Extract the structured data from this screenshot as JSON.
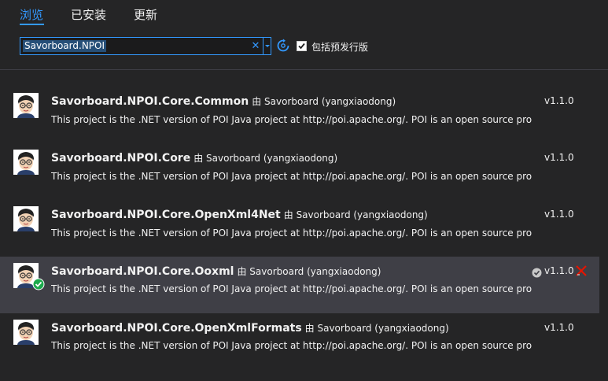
{
  "tabs": [
    {
      "label": "浏览",
      "active": true
    },
    {
      "label": "已安装",
      "active": false
    },
    {
      "label": "更新",
      "active": false
    }
  ],
  "search": {
    "value": "Savorboard.NPOI",
    "clear_icon": "close-icon",
    "dropdown_icon": "chevron-down-icon",
    "refresh_icon": "refresh-icon"
  },
  "prerelease": {
    "label": "包括预发行版",
    "checked": true
  },
  "packages": [
    {
      "name": "Savorboard.NPOI.Core.Common",
      "by": "由 Savorboard (yangxiaodong)",
      "description": "This project is the .NET version of POI Java project at http://poi.apache.org/. POI is an open source pro...",
      "version": "v1.1.0",
      "installed": false,
      "selected": false
    },
    {
      "name": "Savorboard.NPOI.Core",
      "by": "由 Savorboard (yangxiaodong)",
      "description": "This project is the .NET version of POI Java project at http://poi.apache.org/. POI is an open source pro...",
      "version": "v1.1.0",
      "installed": false,
      "selected": false
    },
    {
      "name": "Savorboard.NPOI.Core.OpenXml4Net",
      "by": "由 Savorboard (yangxiaodong)",
      "description": "This project is the .NET version of POI Java project at http://poi.apache.org/. POI is an open source pro...",
      "version": "v1.1.0",
      "installed": false,
      "selected": false
    },
    {
      "name": "Savorboard.NPOI.Core.Ooxml",
      "by": "由 Savorboard (yangxiaodong)",
      "description": "This project is the .NET version of POI Java project at http://poi.apache.org/. POI is an open source pro...",
      "version": "v1.1.0",
      "installed": true,
      "selected": true
    },
    {
      "name": "Savorboard.NPOI.Core.OpenXmlFormats",
      "by": "由 Savorboard (yangxiaodong)",
      "description": "This project is the .NET version of POI Java project at http://poi.apache.org/. POI is an open source pro...",
      "version": "v1.1.0",
      "installed": false,
      "selected": false
    }
  ],
  "colors": {
    "accent": "#3399ff",
    "background": "#252526",
    "selected_row": "#3f3f46",
    "installed_green": "#1ba94c",
    "uninstall_red": "#e51400"
  }
}
